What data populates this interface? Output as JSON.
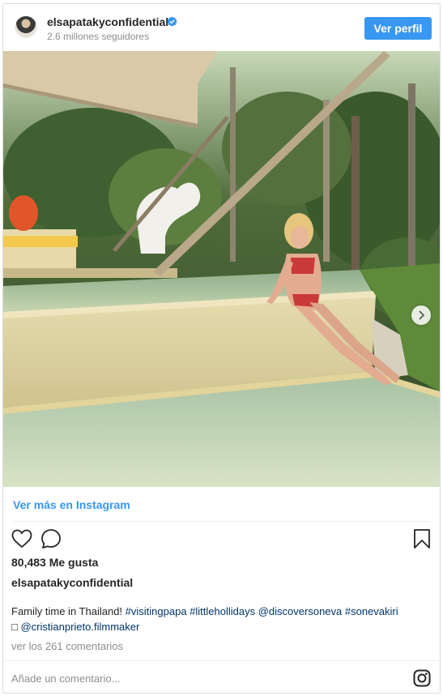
{
  "header": {
    "username": "elsapatakyconfidential",
    "followers": "2.6 millones seguidores",
    "profile_button": "Ver perfil"
  },
  "post": {
    "view_more_link": "Ver más en Instagram",
    "likes": "80,483 Me gusta",
    "author": "elsapatakyconfidential",
    "caption_text": "Family time in Thailand! ",
    "caption_tags": [
      "#visitingpapa",
      "#littlehollidays",
      "@discoversoneva",
      "#sonevakiri"
    ],
    "caption_line2_prefix": "□ ",
    "caption_mention": "@cristianprieto.filmmaker",
    "comments_link": "ver los 261 comentarios",
    "comment_placeholder": "Añade un comentario..."
  },
  "icons": [
    "verified-icon",
    "heart-icon",
    "comment-icon",
    "bookmark-icon",
    "instagram-icon",
    "chevron-right-icon"
  ],
  "colors": {
    "accent": "#3897f0",
    "hashtag": "#003569",
    "muted": "#8e8e8e"
  }
}
